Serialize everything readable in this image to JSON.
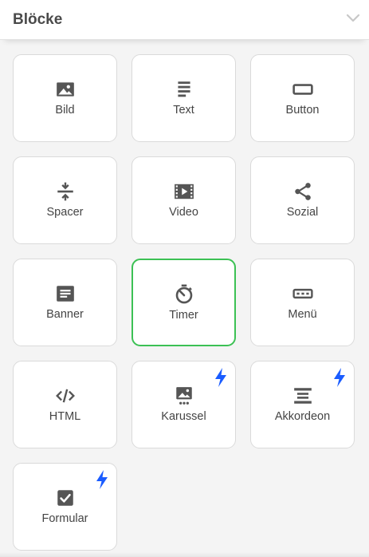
{
  "panel": {
    "title": "Blöcke",
    "collapse_icon": "chevron-down-icon"
  },
  "colors": {
    "selected_border": "#3cc154",
    "bolt": "#1a5cff",
    "icon": "#555555"
  },
  "blocks": [
    {
      "label": "Bild",
      "icon": "image-icon",
      "selected": false,
      "premium": false
    },
    {
      "label": "Text",
      "icon": "text-icon",
      "selected": false,
      "premium": false
    },
    {
      "label": "Button",
      "icon": "button-icon",
      "selected": false,
      "premium": false
    },
    {
      "label": "Spacer",
      "icon": "spacer-icon",
      "selected": false,
      "premium": false
    },
    {
      "label": "Video",
      "icon": "video-icon",
      "selected": false,
      "premium": false
    },
    {
      "label": "Sozial",
      "icon": "share-icon",
      "selected": false,
      "premium": false
    },
    {
      "label": "Banner",
      "icon": "banner-icon",
      "selected": false,
      "premium": false
    },
    {
      "label": "Timer",
      "icon": "timer-icon",
      "selected": true,
      "premium": false
    },
    {
      "label": "Menü",
      "icon": "menu-icon",
      "selected": false,
      "premium": false
    },
    {
      "label": "HTML",
      "icon": "code-icon",
      "selected": false,
      "premium": false
    },
    {
      "label": "Karussel",
      "icon": "carousel-icon",
      "selected": false,
      "premium": true
    },
    {
      "label": "Akkordeon",
      "icon": "accordion-icon",
      "selected": false,
      "premium": true
    },
    {
      "label": "Formular",
      "icon": "form-icon",
      "selected": false,
      "premium": true
    }
  ]
}
